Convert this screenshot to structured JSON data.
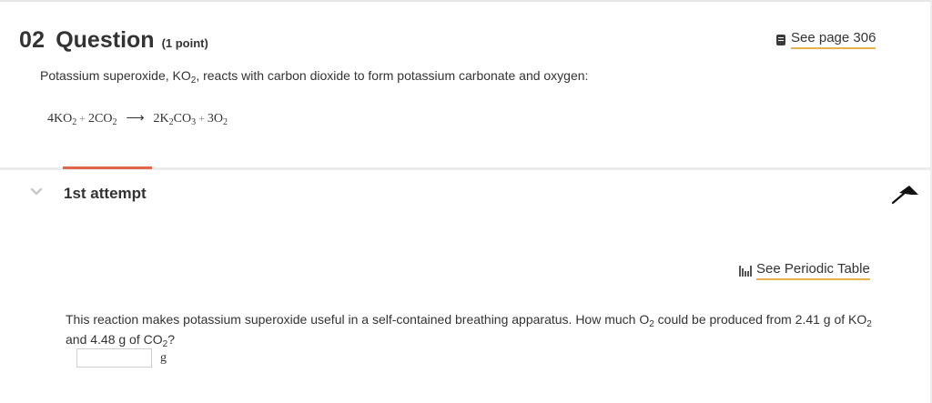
{
  "question": {
    "number": "02",
    "title": "Question",
    "points": "(1 point)",
    "see_page": "See page 306",
    "prompt_pre": "Potassium superoxide, KO",
    "prompt_sub": "2",
    "prompt_post": ", reacts with carbon dioxide to form potassium carbonate and oxygen:",
    "equation": {
      "t1": "4KO",
      "t1s": "2",
      "plus1": "+",
      "t2": "2CO",
      "t2s": "2",
      "arrow": "⟶",
      "t3a": "2K",
      "t3as": "2",
      "t3b": "CO",
      "t3bs": "3",
      "plus2": "+",
      "t4": "3O",
      "t4s": "2"
    }
  },
  "attempt": {
    "label": "1st attempt",
    "see_periodic_table": "See Periodic Table",
    "q_a": "This reaction makes potassium superoxide useful in a self-contained breathing apparatus. How much O",
    "q_a_sub": "2",
    "q_b": " could be produced from 2.41 g of KO",
    "q_b_sub": "2",
    "q_c": " and 4.48 g of CO",
    "q_c_sub": "2",
    "q_d": "?",
    "answer_value": "",
    "unit": "g"
  },
  "colors": {
    "accent": "#e0664a",
    "link_underline": "#e8b04a"
  },
  "icons": [
    "book-icon",
    "chevron-down-icon",
    "pin-icon",
    "periodic-table-icon"
  ]
}
